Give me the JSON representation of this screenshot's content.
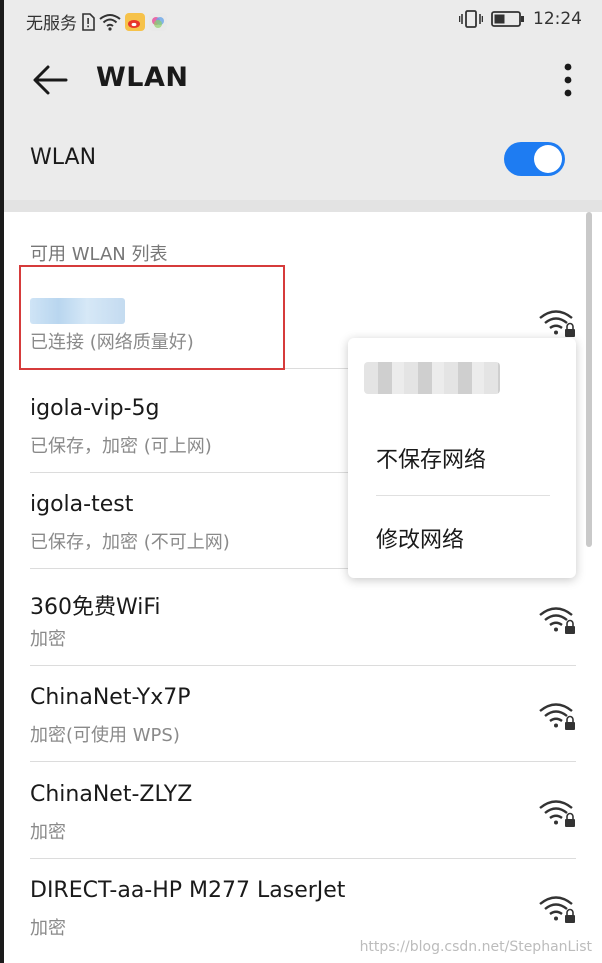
{
  "status_bar": {
    "carrier": "无服务",
    "time": "12:24",
    "icons": [
      "sim-alert-icon",
      "wifi-status-icon",
      "weibo-icon",
      "app-icon",
      "vibrate-icon",
      "battery-icon"
    ]
  },
  "app_bar": {
    "title": "WLAN",
    "back_icon": "arrow-left-icon",
    "more_icon": "more-vert-icon"
  },
  "wlan_toggle": {
    "label": "WLAN",
    "state": "on",
    "accent_color": "#1e7cf2"
  },
  "available_list": {
    "header": "可用 WLAN 列表",
    "networks": [
      {
        "name": "",
        "status": "已连接 (网络质量好)",
        "icon": "wifi-lock-icon",
        "name_obscured": true
      },
      {
        "name": "igola-vip-5g",
        "status": "已保存，加密 (可上网)",
        "icon": "wifi-lock-icon"
      },
      {
        "name": "igola-test",
        "status": "已保存，加密 (不可上网)",
        "icon": "wifi-lock-icon"
      },
      {
        "name": "360免费WiFi",
        "status": "加密",
        "icon": "wifi-lock-icon"
      },
      {
        "name": "ChinaNet-Yx7P",
        "status": "加密(可使用 WPS)",
        "icon": "wifi-lock-icon"
      },
      {
        "name": "ChinaNet-ZLYZ",
        "status": "加密",
        "icon": "wifi-lock-icon"
      },
      {
        "name": "DIRECT-aa-HP M277 LaserJet",
        "status": "加密",
        "icon": "wifi-lock-icon"
      }
    ]
  },
  "context_menu": {
    "title_obscured": true,
    "items": [
      "不保存网络",
      "修改网络"
    ]
  },
  "watermark": "https://blog.csdn.net/StephanList"
}
